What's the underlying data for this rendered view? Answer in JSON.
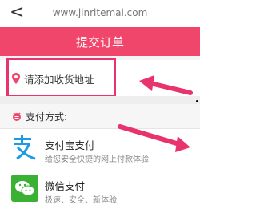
{
  "topbar": {
    "back_glyph": "<",
    "url": "www.jinritemai.com"
  },
  "header": {
    "title": "提交订单"
  },
  "address": {
    "label": "请添加收货地址"
  },
  "payment": {
    "title": "支付方式:",
    "methods": [
      {
        "name": "支付宝支付",
        "desc": "给您安全快捷的网上付款体验",
        "icon": "alipay-icon"
      },
      {
        "name": "微信支付",
        "desc": "极速、安全、新体验",
        "icon": "wechat-icon"
      }
    ]
  },
  "colors": {
    "brand": "#f0466b",
    "annotation": "#e8336d",
    "alipay": "#1a9be6",
    "wechat": "#3ab135"
  }
}
